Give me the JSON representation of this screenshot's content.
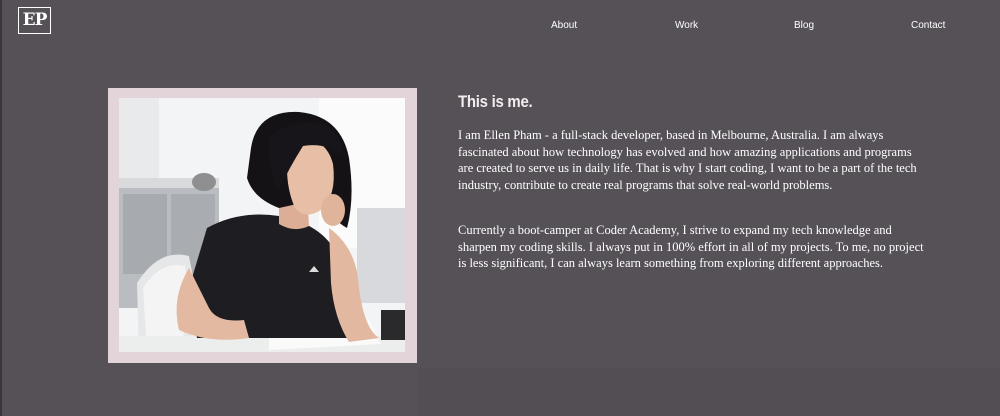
{
  "header": {
    "logo_text": "EP",
    "nav": [
      {
        "label": "About"
      },
      {
        "label": "Work"
      },
      {
        "label": "Blog"
      },
      {
        "label": "Contact"
      }
    ]
  },
  "about": {
    "heading": "This is me.",
    "paragraph1": "I am Ellen Pham - a full-stack developer, based in Melbourne, Australia. I am always fascinated about how technology has evolved and how amazing applications and programs are created to serve us in daily life. That is why I start coding, I want to be a part of the tech industry, contribute to create real programs that solve real-world problems.",
    "paragraph2": "Currently a boot-camper at Coder Academy, I strive to expand my tech knowledge and sharpen my coding skills. I always put in 100% effort in all of my projects. To me, no project is less significant, I can always learn something from exploring different approaches."
  },
  "colors": {
    "background": "#555157",
    "frame": "#e3d4d9",
    "text": "#ffffff"
  }
}
